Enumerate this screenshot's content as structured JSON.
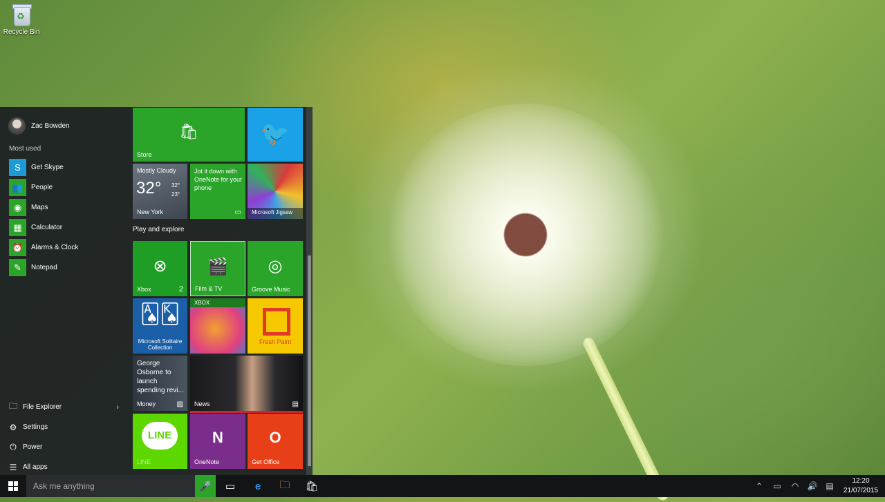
{
  "desktop": {
    "recycle_bin_label": "Recycle Bin"
  },
  "start_menu": {
    "user_name": "Zac Bowden",
    "most_used_heading": "Most used",
    "most_used": [
      {
        "label": "Get Skype",
        "icon": "skype-icon",
        "color": "#1e9bd6"
      },
      {
        "label": "People",
        "icon": "people-icon",
        "color": "#2aa52a"
      },
      {
        "label": "Maps",
        "icon": "maps-icon",
        "color": "#2aa52a"
      },
      {
        "label": "Calculator",
        "icon": "calculator-icon",
        "color": "#2aa52a"
      },
      {
        "label": "Alarms & Clock",
        "icon": "alarm-clock-icon",
        "color": "#2aa52a"
      },
      {
        "label": "Notepad",
        "icon": "notepad-icon",
        "color": "#2aa52a"
      }
    ],
    "bottom_items": [
      {
        "label": "File Explorer",
        "icon": "folder-icon"
      },
      {
        "label": "Settings",
        "icon": "gear-icon"
      },
      {
        "label": "Power",
        "icon": "power-icon"
      },
      {
        "label": "All apps",
        "icon": "list-icon"
      }
    ],
    "group_heading": "Play and explore",
    "tiles": {
      "store": "Store",
      "weather": {
        "condition": "Mostly Cloudy",
        "temp": "32°",
        "high": "32°",
        "low": "23°",
        "city": "New York"
      },
      "onenote_promo": "Jot it down with OneNote for your phone",
      "jigsaw": "Microsoft Jigsaw",
      "xbox": "Xbox",
      "xbox_badge": "2",
      "film_tv": "Film & TV",
      "groove": "Groove Music",
      "solitaire": "Microsoft Solitaire Collection",
      "xbox_tag": "XBOX",
      "fresh_paint": "Fresh Paint",
      "money_headline": "George Osborne to launch spending revi...",
      "money": "Money",
      "news": "News",
      "line_logo": "LINE",
      "line": "LINE",
      "onenote": "OneNote",
      "get_office": "Get Office"
    }
  },
  "taskbar": {
    "search_placeholder": "Ask me anything",
    "time": "12:20",
    "date": "21/07/2015"
  },
  "colors": {
    "accent_green": "#2aa52a",
    "twitter_blue": "#1aa1e8",
    "fresh_paint_yellow": "#f5c800",
    "office_orange": "#e74018",
    "onenote_purple": "#7b2d8b",
    "line_green": "#5cd800"
  }
}
